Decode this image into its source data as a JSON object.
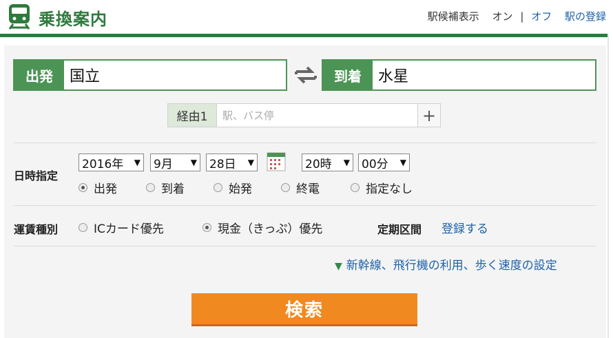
{
  "header": {
    "title": "乗換案内",
    "nav": {
      "station_candidates_label": "駅候補表示",
      "on_label": "オン",
      "separator": "|",
      "off_label": "オフ",
      "register_station_label": "駅の登録"
    }
  },
  "departure": {
    "tag": "出発",
    "value": "国立"
  },
  "arrival": {
    "tag": "到着",
    "value": "水星"
  },
  "via": {
    "tag": "経由1",
    "placeholder": "駅、バス停",
    "plus": "+"
  },
  "datetime": {
    "label": "日時指定",
    "year": "2016年",
    "month": "9月",
    "day": "28日",
    "hour": "20時",
    "minute": "00分",
    "dropdown_arrow": "▼",
    "options": [
      {
        "label": "出発",
        "selected": true
      },
      {
        "label": "到着",
        "selected": false
      },
      {
        "label": "始発",
        "selected": false
      },
      {
        "label": "終電",
        "selected": false
      },
      {
        "label": "指定なし",
        "selected": false
      }
    ]
  },
  "fare": {
    "label": "運賃種別",
    "options": [
      {
        "label": "ICカード優先",
        "selected": false
      },
      {
        "label": "現金（きっぷ）優先",
        "selected": true
      }
    ],
    "commuter_label": "定期区間",
    "commuter_link": "登録する"
  },
  "settings_link": {
    "arrow": "▼",
    "text": "新幹線、飛行機の利用、歩く速度の設定"
  },
  "search_button": "検索",
  "colors": {
    "brand_green": "#2f7a3d",
    "tag_green": "#4c9455",
    "link_blue": "#1d62a8",
    "search_orange": "#f0891f"
  },
  "icons": {
    "logo": "train-icon",
    "swap": "swap-arrows-icon",
    "calendar": "calendar-icon"
  }
}
